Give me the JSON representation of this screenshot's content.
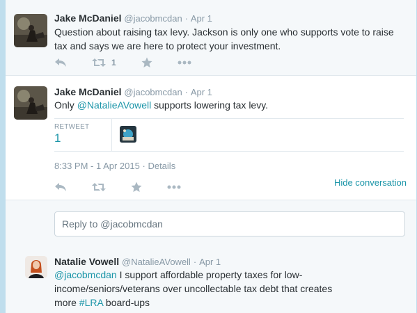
{
  "tweets": [
    {
      "fullname": "Jake McDaniel",
      "username": "@jacobmcdan",
      "separator": "·",
      "time": "Apr 1",
      "text": "Question about raising tax levy. Jackson is only one who supports vote to raise tax and says we are here to protect your investment.",
      "retweet_count": "1"
    },
    {
      "fullname": "Jake McDaniel",
      "username": "@jacobmcdan",
      "separator": "·",
      "time": "Apr 1",
      "text_before": "Only ",
      "mention": "@NatalieAVowell",
      "text_after": " supports lowering tax levy.",
      "stat_label": "RETWEET",
      "stat_value": "1",
      "timestamp": "8:33 PM - 1 Apr 2015",
      "meta_separator": "·",
      "details": "Details",
      "hide_conversation": "Hide conversation"
    },
    {
      "fullname": "Natalie Vowell",
      "username": "@NatalieAVowell",
      "separator": "·",
      "time": "Apr 1",
      "mention": "@jacobmcdan",
      "text_middle": " I support affordable property taxes for low-income/seniors/veterans over uncollectable tax debt that creates more ",
      "hashtag": "#LRA",
      "text_after": " board-ups"
    }
  ],
  "reply_box": {
    "placeholder": "Reply to @jacobmcdan"
  },
  "actions": {
    "icons": [
      "reply-icon",
      "retweet-icon",
      "favorite-icon",
      "more-icon"
    ]
  },
  "colors": {
    "background": "#c0deed",
    "link": "#1b95a8",
    "muted": "#8899a6",
    "icon": "#aab8c2"
  }
}
